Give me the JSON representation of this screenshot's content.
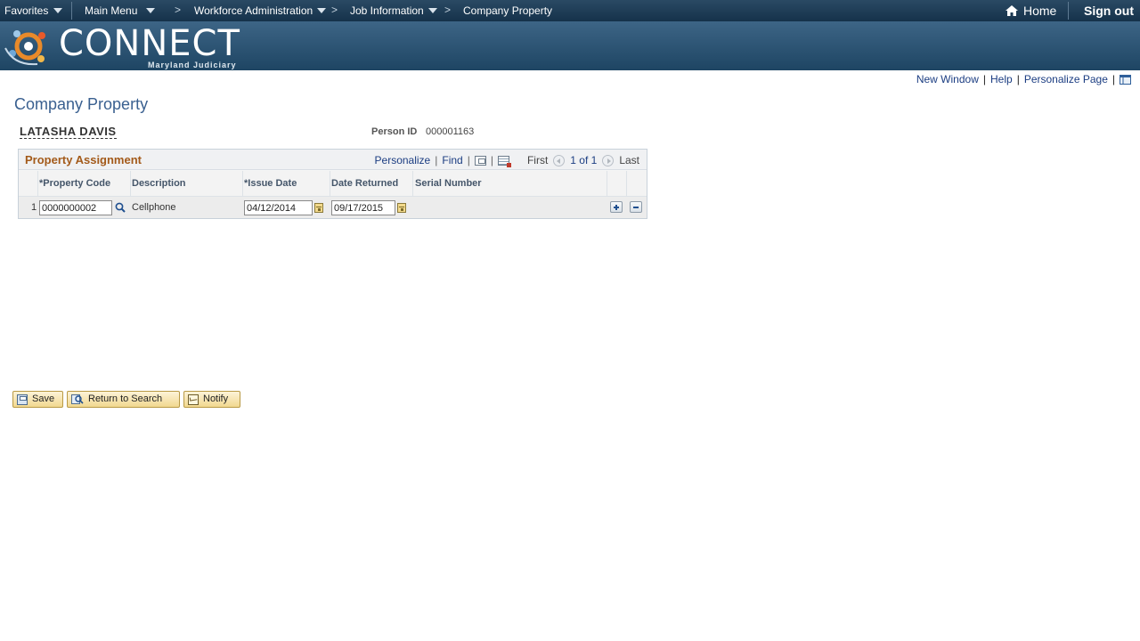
{
  "nav": {
    "favorites": "Favorites",
    "main_menu": "Main Menu",
    "sep": ">",
    "breadcrumb": [
      "Workforce Administration",
      "Job Information",
      "Company Property"
    ],
    "home": "Home",
    "sign_out": "Sign out"
  },
  "brand": {
    "name": "CONNECT",
    "subtitle": "Maryland Judiciary",
    "colors": {
      "nav_bg": "#1b3a55",
      "banner_bg": "#2e5677"
    }
  },
  "page_links": {
    "new_window": "New Window",
    "help": "Help",
    "personalize_page": "Personalize Page",
    "sep": "|"
  },
  "page": {
    "title": "Company Property",
    "person_name": "LATASHA DAVIS",
    "person_id_label": "Person ID",
    "person_id": "000001163"
  },
  "grid": {
    "title": "Property Assignment",
    "personalize": "Personalize",
    "find": "Find",
    "sep": "|",
    "first": "First",
    "range": "1 of 1",
    "last": "Last",
    "columns": [
      "*Property Code",
      "Description",
      "*Issue Date",
      "Date Returned",
      "Serial Number"
    ],
    "rows": [
      {
        "num": "1",
        "property_code": "0000000002",
        "description": "Cellphone",
        "issue_date": "04/12/2014",
        "date_returned": "09/17/2015",
        "serial_number": ""
      }
    ]
  },
  "buttons": {
    "save": "Save",
    "return_to_search": "Return to Search",
    "notify": "Notify"
  },
  "icons": {
    "home": "home-icon",
    "lookup": "magnifier-icon",
    "calendar": "calendar-icon",
    "add_row": "plus-icon",
    "delete_row": "minus-icon",
    "new_window": "new-window-icon",
    "download": "download-excel-icon",
    "prev": "chevron-left-icon",
    "next": "chevron-right-icon"
  }
}
